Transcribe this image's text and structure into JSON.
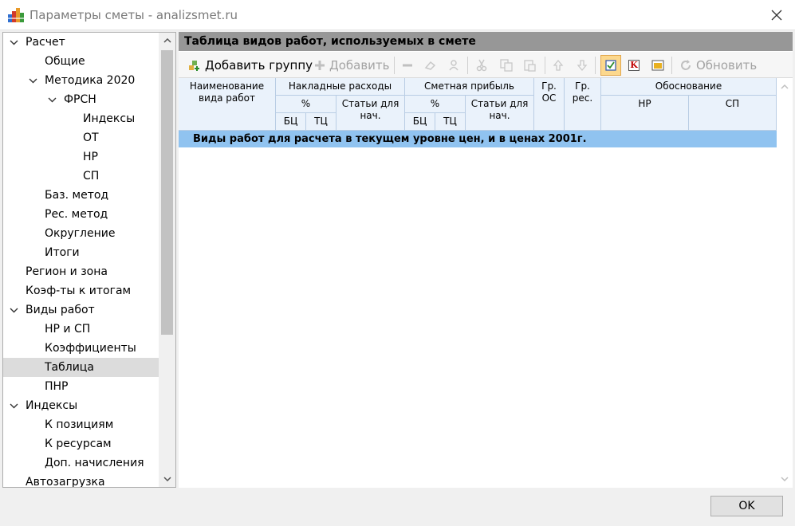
{
  "window": {
    "title": "Параметры сметы - analizsmet.ru",
    "close_glyph": "✕"
  },
  "tree": {
    "items": [
      {
        "label": "Расчет",
        "expander": "open"
      },
      {
        "label": "Общие"
      },
      {
        "label": "Методика 2020",
        "expander": "open"
      },
      {
        "label": "ФРСН",
        "expander": "open"
      },
      {
        "label": "Индексы"
      },
      {
        "label": "ОТ"
      },
      {
        "label": "НР"
      },
      {
        "label": "СП"
      },
      {
        "label": "Баз. метод"
      },
      {
        "label": "Рес. метод"
      },
      {
        "label": "Округление"
      },
      {
        "label": "Итоги"
      },
      {
        "label": "Регион и зона"
      },
      {
        "label": "Коэф-ты к итогам"
      },
      {
        "label": "Виды работ",
        "expander": "open"
      },
      {
        "label": "НР и СП"
      },
      {
        "label": "Коэффициенты"
      },
      {
        "label": "Таблица",
        "selected": true
      },
      {
        "label": "ПНР"
      },
      {
        "label": "Индексы",
        "expander": "open"
      },
      {
        "label": "К позициям"
      },
      {
        "label": "К ресурсам"
      },
      {
        "label": "Доп. начисления"
      },
      {
        "label": "Автозагрузка"
      }
    ]
  },
  "panel": {
    "title": "Таблица видов работ, используемых в смете"
  },
  "toolbar": {
    "add_group": "Добавить группу",
    "add": "Добавить",
    "refresh": "Обновить",
    "k_label": "K"
  },
  "grid": {
    "headers": {
      "name": "Наименование вида работ",
      "overhead": "Накладные расходы",
      "profit": "Сметная прибыль",
      "percent": "%",
      "articles": "Статьи для нач.",
      "bc": "БЦ",
      "tc": "ТЦ",
      "gr_os": "Гр. ОС",
      "gr_res": "Гр. рес.",
      "basis": "Обоснование",
      "nr": "НР",
      "sp": "СП"
    },
    "group_row": "Виды работ для расчета в текущем уровне цен, и в ценах 2001г."
  },
  "footer": {
    "ok": "OK"
  },
  "colors": {
    "panel_header": "#979797",
    "group_row": "#90c3f0",
    "header_bg": "#eaf2fb",
    "selected": "#dcdcdc"
  }
}
